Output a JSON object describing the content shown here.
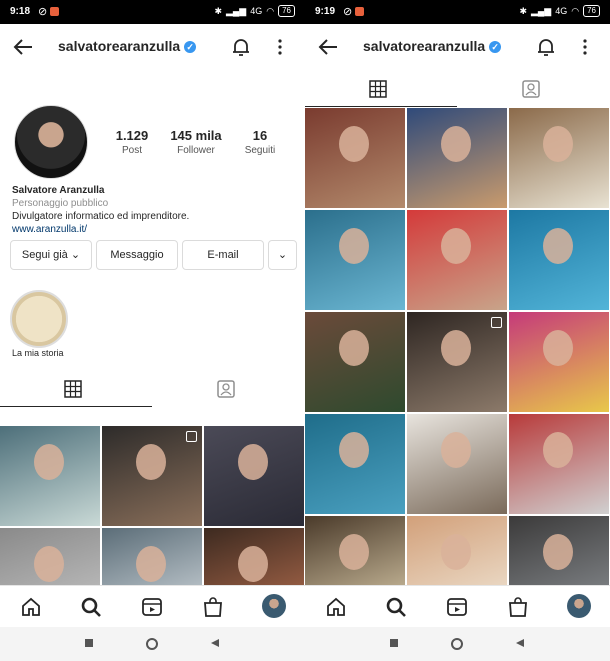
{
  "left": {
    "status": {
      "time": "9:18",
      "signal": "4G",
      "battery": "76"
    },
    "username": "salvatorearanzulla",
    "stats": [
      {
        "value": "1.129",
        "label": "Post"
      },
      {
        "value": "145 mila",
        "label": "Follower"
      },
      {
        "value": "16",
        "label": "Seguiti"
      }
    ],
    "profile": {
      "name": "Salvatore Aranzulla",
      "category": "Personaggio pubblico",
      "bio": "Divulgatore informatico ed imprenditore.",
      "link": "www.aranzulla.it/"
    },
    "buttons": {
      "follow": "Segui già",
      "message": "Messaggio",
      "email": "E-mail"
    },
    "highlight_label": "La mia storia",
    "grid": [
      {
        "colors": [
          "#4d6f7a",
          "#c9d9d6"
        ],
        "multi": false
      },
      {
        "colors": [
          "#2d2b2a",
          "#8a6f5a"
        ],
        "multi": true
      },
      {
        "colors": [
          "#4b4a57",
          "#2a2a35"
        ],
        "multi": false
      },
      {
        "colors": [
          "#8a8a8a",
          "#c8c8c8"
        ],
        "multi": false
      },
      {
        "colors": [
          "#5b6d78",
          "#d9dfe3"
        ],
        "multi": false
      },
      {
        "colors": [
          "#3d2a20",
          "#b87050"
        ],
        "multi": false
      }
    ]
  },
  "right": {
    "status": {
      "time": "9:19",
      "signal": "4G",
      "battery": "76"
    },
    "username": "salvatorearanzulla",
    "grid": [
      {
        "colors": [
          "#7a3b2f",
          "#b38a6c"
        ],
        "multi": false
      },
      {
        "colors": [
          "#2f4a7a",
          "#c99b6d"
        ],
        "multi": false
      },
      {
        "colors": [
          "#8b6a4a",
          "#e8e2d2"
        ],
        "multi": false
      },
      {
        "colors": [
          "#2b6f8c",
          "#6bb6d2"
        ],
        "multi": false
      },
      {
        "colors": [
          "#d43a3a",
          "#c8a48a"
        ],
        "multi": false
      },
      {
        "colors": [
          "#1d78a3",
          "#52b4d8"
        ],
        "multi": false
      },
      {
        "colors": [
          "#6b4a3a",
          "#2e4a2e"
        ],
        "multi": false
      },
      {
        "colors": [
          "#2e2622",
          "#8c7a6a"
        ],
        "multi": true
      },
      {
        "colors": [
          "#c53a7a",
          "#e8c84a"
        ],
        "multi": false
      },
      {
        "colors": [
          "#1f6d8a",
          "#4aa0c0"
        ],
        "multi": false
      },
      {
        "colors": [
          "#e8e4de",
          "#7a6a5a"
        ],
        "multi": false
      },
      {
        "colors": [
          "#b83a3a",
          "#d0d0d0"
        ],
        "multi": false
      },
      {
        "colors": [
          "#4a3a2a",
          "#d8c9a8"
        ],
        "multi": false
      },
      {
        "colors": [
          "#d2a07a",
          "#f0e6d6"
        ],
        "multi": false
      },
      {
        "colors": [
          "#3b3a3a",
          "#8a8e92"
        ],
        "multi": false
      }
    ]
  }
}
